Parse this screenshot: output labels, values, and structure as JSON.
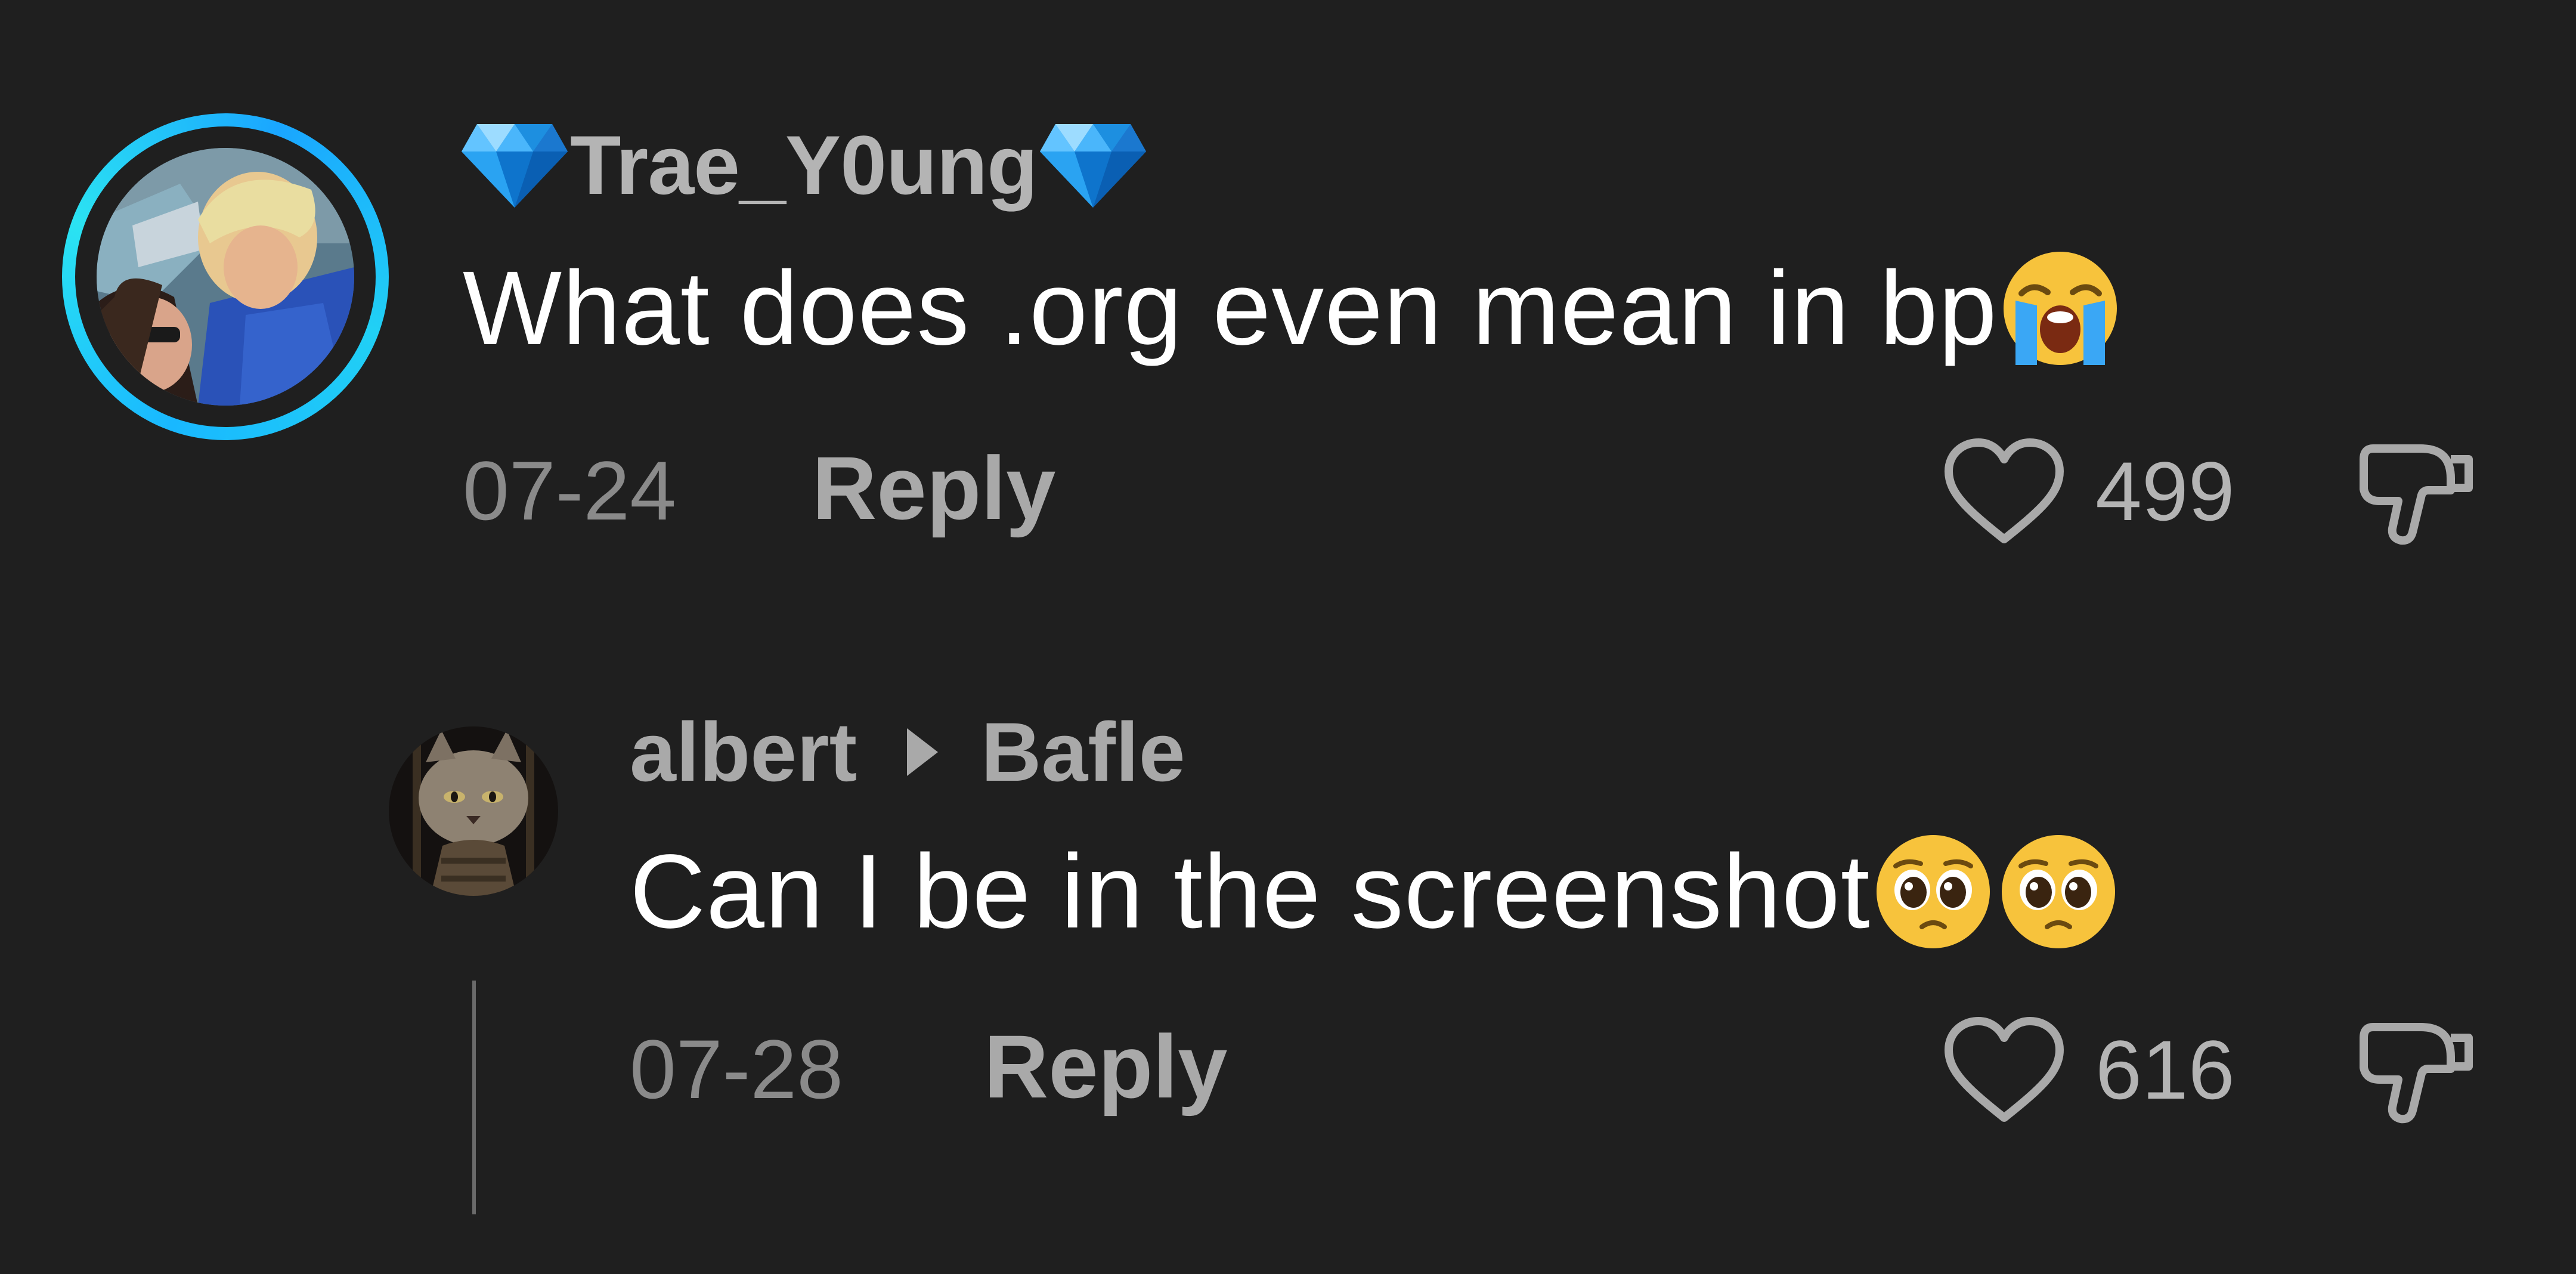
{
  "comments": [
    {
      "username": "Trae_Y0ung",
      "text": "What does .org even mean in bp",
      "text_emoji": "loudly-crying-face",
      "date": "07-24",
      "reply_label": "Reply",
      "likes": "499"
    }
  ],
  "reply": {
    "username": "albert",
    "reply_to": "Bafle",
    "text": "Can I be in the screenshot",
    "text_emoji": [
      "pleading-face",
      "pleading-face"
    ],
    "date": "07-28",
    "reply_label": "Reply",
    "likes": "616"
  },
  "colors": {
    "background": "#1f1f1f",
    "avatar_ring": "#19b8ff",
    "primary_text": "#ffffff",
    "secondary_text": "#a9a9a9"
  },
  "icons": {
    "username_badge": "diamond-icon",
    "like": "heart-outline-icon",
    "dislike": "thumbs-down-outline-icon"
  }
}
